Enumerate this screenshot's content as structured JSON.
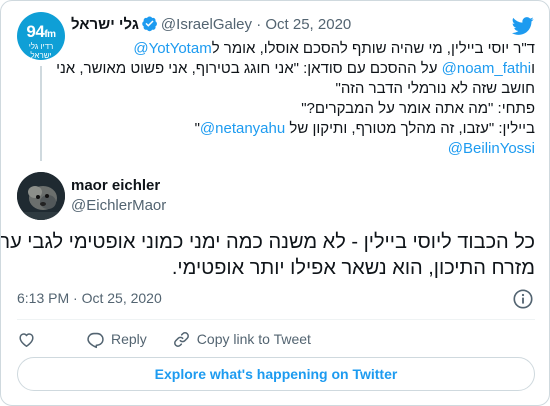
{
  "colors": {
    "accent": "#1d9bf0",
    "text_primary": "#0f1419",
    "text_secondary": "#536471",
    "border": "#cfd9de",
    "logo_bg": "#0f9fd6"
  },
  "header": {
    "icon": "twitter-bird-icon"
  },
  "quoted_tweet": {
    "avatar_logo": {
      "number": "94",
      "unit": "fm",
      "subtitle": "רדיו גלי ישראל"
    },
    "display_name": "גלי ישראל",
    "verified_icon": "verified-badge-icon",
    "handle": "@IsraelGaley",
    "separator": "·",
    "date": "Oct 25, 2020",
    "text_lines": [
      {
        "segments": [
          {
            "text": "ד\"ר יוסי ביילין, מי שהיה שותף להסכם אוסלו, אומר ל",
            "type": "text"
          },
          {
            "text": "@YotYotam",
            "type": "mention"
          }
        ]
      },
      {
        "segments": [
          {
            "text": "ו",
            "type": "text"
          },
          {
            "text": "@noam_fathi",
            "type": "mention"
          },
          {
            "text": " על ההסכם עם סודאן: \"אני חוגג בטירוף, אני פשוט מאושר, אני",
            "type": "text"
          }
        ]
      },
      {
        "segments": [
          {
            "text": "חושב שזה לא נורמלי הדבר הזה\"",
            "type": "text"
          }
        ]
      },
      {
        "segments": [
          {
            "text": "פתחי: \"מה אתה אומר על המבקרים?\"",
            "type": "text"
          }
        ]
      },
      {
        "segments": [
          {
            "text": "ביילין: \"עזבו, זה מהלך מטורף, ותיקון של ",
            "type": "text"
          },
          {
            "text": "@netanyahu",
            "type": "mention"
          },
          {
            "text": "\"",
            "type": "text"
          }
        ]
      },
      {
        "segments": [
          {
            "text": "@BeilinYossi",
            "type": "mention"
          }
        ]
      }
    ]
  },
  "main_tweet": {
    "avatar_icon": "user-avatar",
    "display_name": "maor eichler",
    "handle": "@EichlerMaor",
    "text_lines": [
      "כל הכבוד ליוסי ביילין - לא משנה כמה ימני כמוני אופטימי לגבי עתיד",
      "מזרח התיכון, הוא נשאר אפילו יותר אופטימי."
    ],
    "time": "6:13 PM",
    "separator": "·",
    "date": "Oct 25, 2020",
    "info_icon": "info-icon"
  },
  "actions": {
    "like_icon": "heart-icon",
    "reply_label": "Reply",
    "reply_icon": "reply-bubble-icon",
    "copy_label": "Copy link to Tweet",
    "copy_icon": "link-icon"
  },
  "footer": {
    "explore_label": "Explore what's happening on Twitter"
  }
}
